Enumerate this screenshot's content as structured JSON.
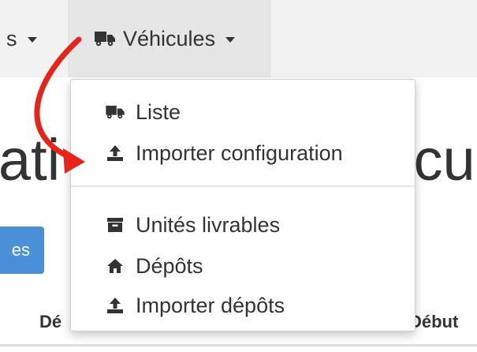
{
  "navbar": {
    "prev_item_label": "s",
    "vehicules_label": "Véhicules",
    "vehicules_icon": "truck-icon"
  },
  "page": {
    "title_left": "ati",
    "title_right": "icu",
    "blue_button_label": "es",
    "table_header_left": "Dé",
    "table_header_right": "Début"
  },
  "dropdown": {
    "items": [
      {
        "label": "Liste",
        "icon": "truck-icon"
      },
      {
        "label": "Importer configuration",
        "icon": "upload-icon"
      },
      {
        "label": "Unités livrables",
        "icon": "archive-icon"
      },
      {
        "label": "Dépôts",
        "icon": "home-icon"
      },
      {
        "label": "Importer dépôts",
        "icon": "upload-icon"
      }
    ]
  },
  "colors": {
    "navbar_bg": "#f2f2f2",
    "active_nav_bg": "#e6e6e6",
    "button_blue": "#4a90d9",
    "annotation_arrow": "#e8231a",
    "text": "#333333"
  }
}
